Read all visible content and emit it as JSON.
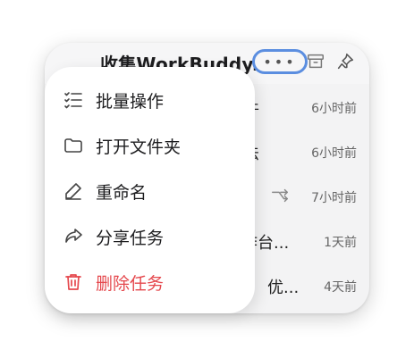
{
  "header": {
    "title": "收集WorkBuddy...",
    "more_label": "•••"
  },
  "tasks": [
    {
      "title": "件",
      "time": "6小时前"
    },
    {
      "title": "法",
      "time": "6小时前"
    },
    {
      "title": "",
      "time": "7小时前",
      "icon": "share-arrow-icon"
    },
    {
      "title": "作台...",
      "time": "1天前"
    },
    {
      "title": "优...",
      "time": "4天前"
    }
  ],
  "menu": {
    "items": [
      {
        "label": "批量操作",
        "icon": "checklist-icon"
      },
      {
        "label": "打开文件夹",
        "icon": "folder-icon"
      },
      {
        "label": "重命名",
        "icon": "pencil-icon"
      },
      {
        "label": "分享任务",
        "icon": "share-icon"
      },
      {
        "label": "删除任务",
        "icon": "trash-icon",
        "color": "#e5484d"
      }
    ]
  },
  "colors": {
    "focus_ring": "#5b8ee0",
    "danger": "#e5484d"
  }
}
